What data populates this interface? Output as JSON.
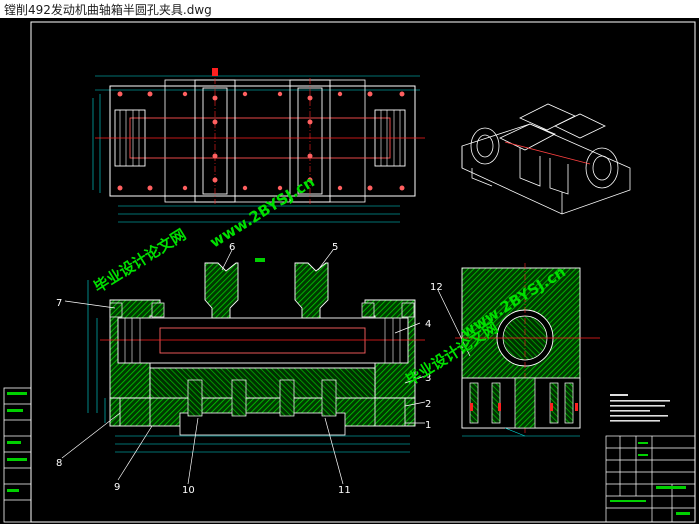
{
  "window": {
    "title": "镗削492发动机曲轴箱半圆孔夹具.dwg"
  },
  "callouts": [
    "1",
    "2",
    "3",
    "4",
    "5",
    "6",
    "7",
    "8",
    "9",
    "10",
    "11",
    "12"
  ],
  "watermarks": {
    "site_cn": "毕业设计论文网",
    "site_url": "www.2BYSJ.cn"
  },
  "colors": {
    "background": "#000000",
    "outline": "#ffffff",
    "hatch": "#00c000",
    "centerline": "#ff2020",
    "part": "#ff6060",
    "dimension": "#00e0e0",
    "watermark": "#00e000"
  }
}
